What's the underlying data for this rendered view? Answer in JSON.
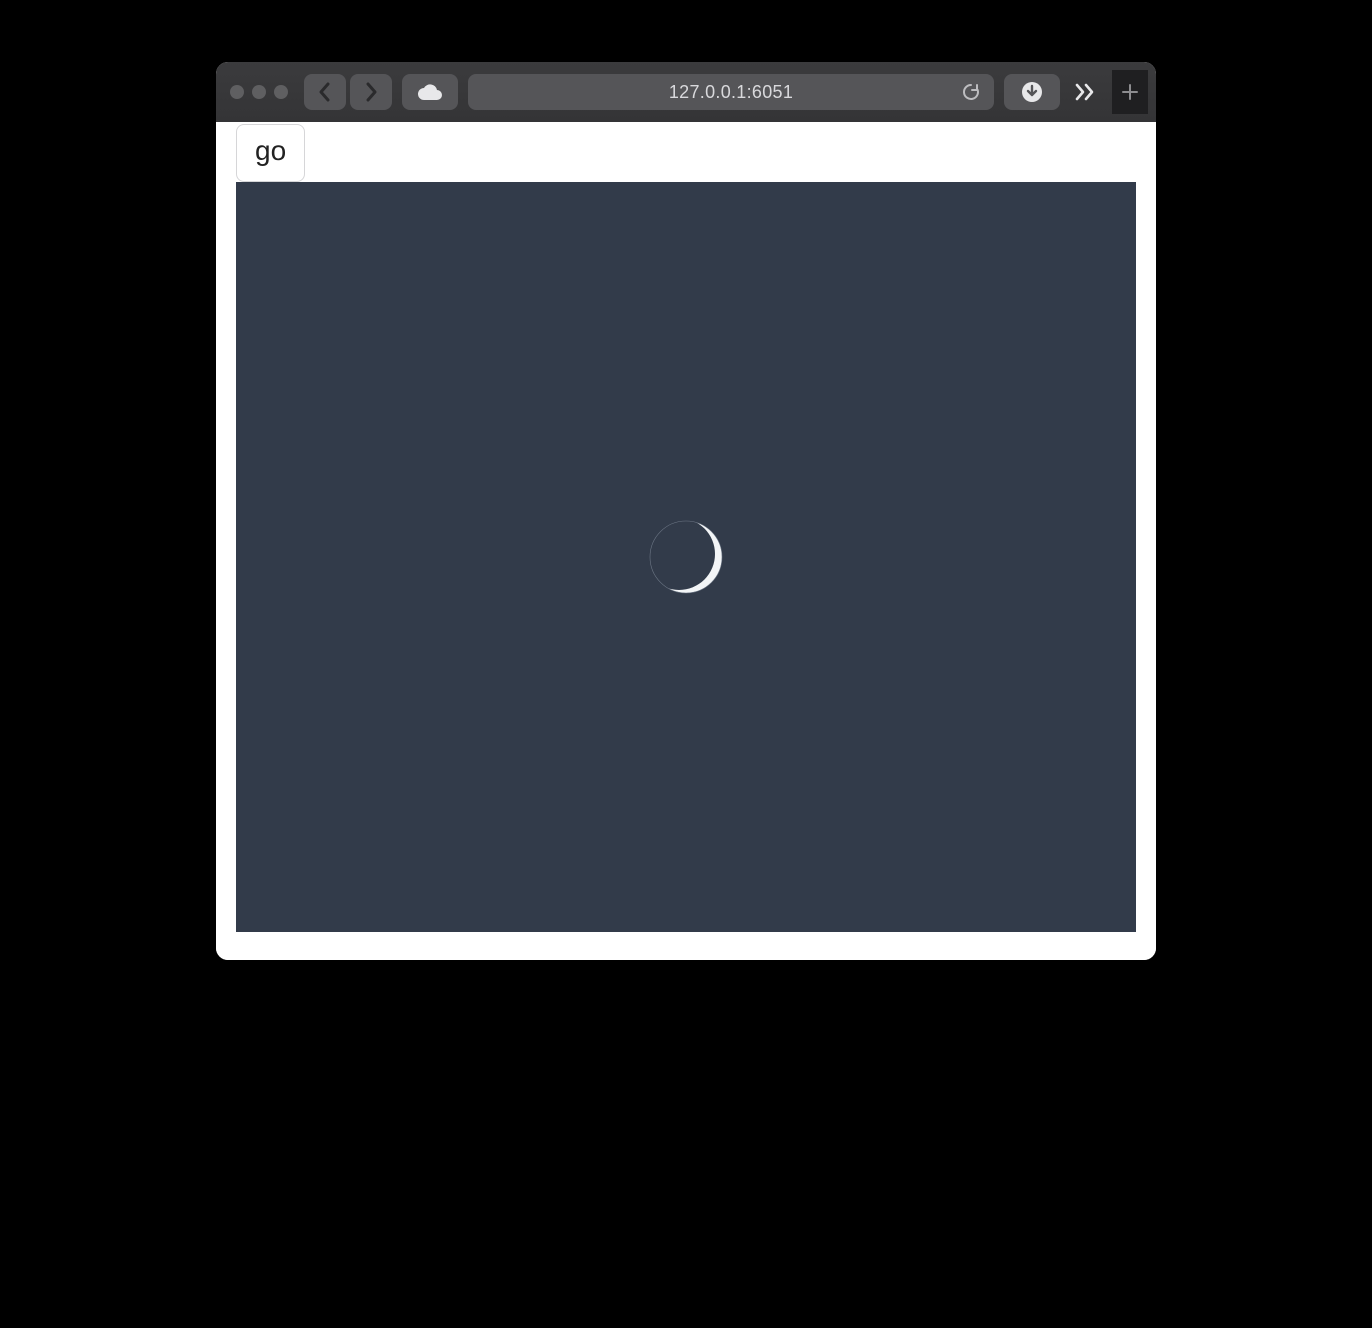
{
  "browser": {
    "url": "127.0.0.1:6051"
  },
  "page": {
    "go_button_label": "go",
    "canvas_bg": "#323b4a"
  }
}
